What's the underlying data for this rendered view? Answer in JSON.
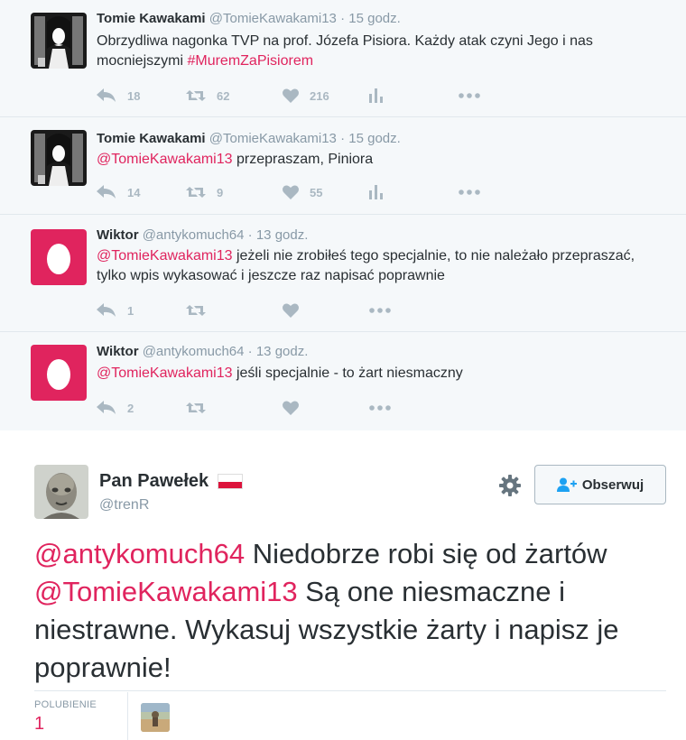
{
  "replies": [
    {
      "name": "Tomie Kawakami",
      "handle": "@TomieKawakami13",
      "time": "15 godz.",
      "text_plain": "Obrzydliwa nagonka TVP na prof. Józefa Pisiora. Każdy atak czyni Jego i nas mocniejszymi ",
      "hashtag": "#MuremZaPisiorem",
      "replies": "18",
      "retweets": "62",
      "likes": "216",
      "avatar": "tomie-avatar"
    },
    {
      "name": "Tomie Kawakami",
      "handle": "@TomieKawakami13",
      "time": "15 godz.",
      "mention": "@TomieKawakami13",
      "text": " przepraszam, Piniora",
      "replies": "14",
      "retweets": "9",
      "likes": "55",
      "avatar": "tomie-avatar"
    },
    {
      "name": "Wiktor",
      "handle": "@antykomuch64",
      "time": "13 godz.",
      "mention": "@TomieKawakami13",
      "text": " jeżeli nie zrobiłeś tego specjalnie, to nie  należało przepraszać, tylko wpis wykasować i jeszcze raz napisać poprawnie",
      "replies": "1",
      "retweets": "",
      "likes": "",
      "avatar": "egg-avatar"
    },
    {
      "name": "Wiktor",
      "handle": "@antykomuch64",
      "time": "13 godz.",
      "mention": "@TomieKawakami13",
      "text": " jeśli specjalnie - to żart niesmaczny",
      "replies": "2",
      "retweets": "",
      "likes": "",
      "avatar": "egg-avatar"
    }
  ],
  "dot": "·",
  "main": {
    "name": "Pan Pawełek",
    "handle": "@trenR",
    "follow_label": "Obserwuj",
    "mention1": "@antykomuch64",
    "text1": " Niedobrze robi się od żartów ",
    "mention2": "@TomieKawakami13",
    "text2": " Są one niesmaczne i niestrawne. Wykasuj wszystkie żarty i napisz je poprawnie!",
    "likes_label": "POLUBIENIE",
    "likes_count": "1"
  },
  "colors": {
    "accent": "#e0245e",
    "muted": "#8899a6",
    "icon": "#aab8c2",
    "egg_bg": "#e0245e"
  }
}
